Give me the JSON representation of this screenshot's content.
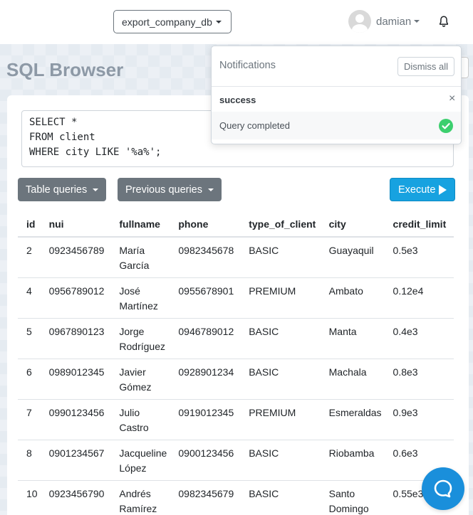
{
  "navbar": {
    "database": "export_company_db",
    "username": "damian"
  },
  "page": {
    "title": "SQL Browser"
  },
  "editor": {
    "query": "SELECT *\nFROM client\nWHERE city LIKE '%a%';"
  },
  "toolbar": {
    "table_queries_label": "Table queries",
    "previous_queries_label": "Previous queries",
    "execute_label": "Execute"
  },
  "table": {
    "columns": [
      "id",
      "nui",
      "fullname",
      "phone",
      "type_of_client",
      "city",
      "credit_limit"
    ],
    "rows": [
      {
        "id": "2",
        "nui": "0923456789",
        "fullname_first": "María",
        "fullname_last": "García",
        "phone": "0982345678",
        "type": "BASIC",
        "city_1": "Guayaquil",
        "city_2": "",
        "credit": "0.5e3"
      },
      {
        "id": "4",
        "nui": "0956789012",
        "fullname_first": "José",
        "fullname_last": "Martínez",
        "phone": "0955678901",
        "type": "PREMIUM",
        "city_1": "Ambato",
        "city_2": "",
        "credit": "0.12e4"
      },
      {
        "id": "5",
        "nui": "0967890123",
        "fullname_first": "Jorge",
        "fullname_last": "Rodríguez",
        "phone": "0946789012",
        "type": "BASIC",
        "city_1": "Manta",
        "city_2": "",
        "credit": "0.4e3"
      },
      {
        "id": "6",
        "nui": "0989012345",
        "fullname_first": "Javier",
        "fullname_last": "Gómez",
        "phone": "0928901234",
        "type": "BASIC",
        "city_1": "Machala",
        "city_2": "",
        "credit": "0.8e3"
      },
      {
        "id": "7",
        "nui": "0990123456",
        "fullname_first": "Julio",
        "fullname_last": "Castro",
        "phone": "0919012345",
        "type": "PREMIUM",
        "city_1": "Esmeraldas",
        "city_2": "",
        "credit": "0.9e3"
      },
      {
        "id": "8",
        "nui": "0901234567",
        "fullname_first": "Jacqueline",
        "fullname_last": "López",
        "phone": "0900123456",
        "type": "BASIC",
        "city_1": "Riobamba",
        "city_2": "",
        "credit": "0.6e3"
      },
      {
        "id": "10",
        "nui": "0923456790",
        "fullname_first": "Andrés",
        "fullname_last": "Ramírez",
        "phone": "0982345679",
        "type": "BASIC",
        "city_1": "Santo",
        "city_2": "Domingo",
        "credit": "0.55e3"
      }
    ]
  },
  "notifications": {
    "title": "Notifications",
    "dismiss_label": "Dismiss all",
    "items": [
      {
        "type": "success",
        "message": "Query completed",
        "close": "×"
      }
    ]
  },
  "colors": {
    "execute": "#17a2e0",
    "secondary": "#6c757d",
    "success": "#3ccf6e",
    "help": "#1a8fdb"
  },
  "icons": {
    "bell": "bell-icon",
    "check": "check-circle-icon",
    "help": "chat-bubble-icon"
  }
}
